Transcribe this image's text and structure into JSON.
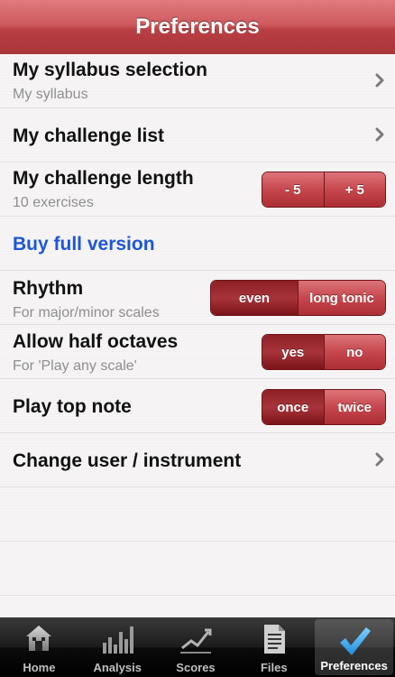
{
  "navbar": {
    "title": "Preferences"
  },
  "rows": {
    "syllabus": {
      "title": "My syllabus selection",
      "subtitle": "My syllabus"
    },
    "challenge_list": {
      "title": "My challenge list"
    },
    "challenge_length": {
      "title": "My challenge length",
      "subtitle": "10 exercises",
      "minus": "- 5",
      "plus": "+ 5"
    },
    "buy": {
      "title": "Buy full version"
    },
    "rhythm": {
      "title": "Rhythm",
      "subtitle": "For major/minor scales",
      "options": [
        "even",
        "long tonic"
      ],
      "selected": "even"
    },
    "half_octaves": {
      "title": "Allow half octaves",
      "subtitle": "For 'Play any scale'",
      "options": [
        "yes",
        "no"
      ],
      "selected": "yes"
    },
    "top_note": {
      "title": "Play top note",
      "options": [
        "once",
        "twice"
      ],
      "selected": "once"
    },
    "change_user": {
      "title": "Change user / instrument"
    }
  },
  "tabbar": {
    "tabs": [
      {
        "label": "Home",
        "icon": "house-icon"
      },
      {
        "label": "Analysis",
        "icon": "bar-chart-icon"
      },
      {
        "label": "Scores",
        "icon": "line-chart-icon"
      },
      {
        "label": "Files",
        "icon": "document-icon"
      },
      {
        "label": "Preferences",
        "icon": "checkmark-icon"
      }
    ],
    "active": "Preferences"
  },
  "colors": {
    "accent": "#c0444a",
    "link": "#1e55d8"
  }
}
